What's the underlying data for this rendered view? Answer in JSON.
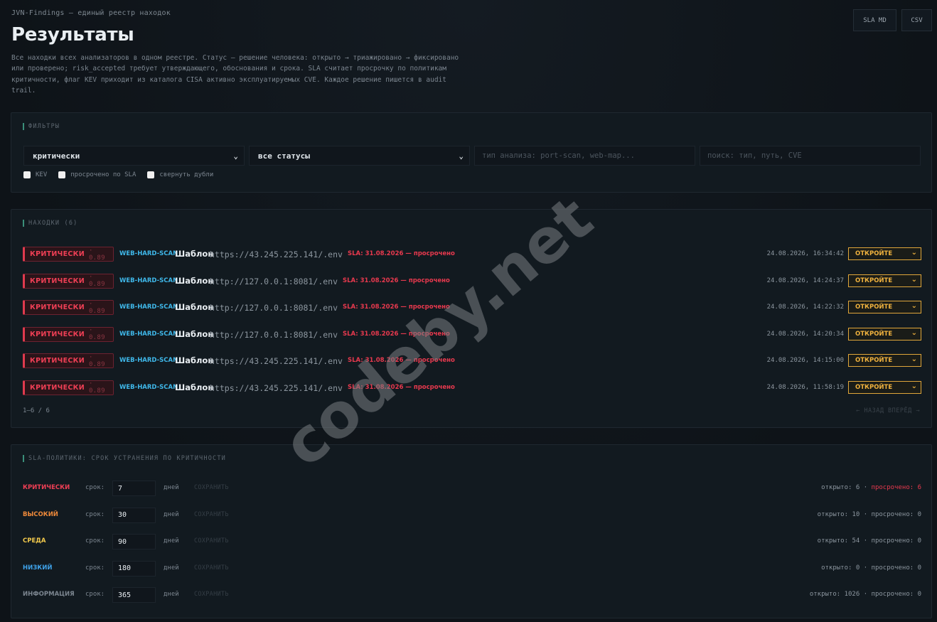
{
  "header": {
    "crumb": "JVN-Findings — единый реестр находок",
    "title": "Результаты",
    "description": "Все находки всех анализаторов в одном реестре. Статус — решение человека: открыто → триажировано → фиксировано или проверено; risk_accepted требует утверждающего, обоснования и срока. SLA считает просрочку по политикам критичности, флаг KEV приходит из каталога CISA активно эксплуатируемых CVE. Каждое решение пишется в audit trail.",
    "btn_sla_md": "SLA MD",
    "btn_csv": "CSV"
  },
  "filters": {
    "title": "ФИЛЬТРЫ",
    "severity_selected": "критически",
    "status_selected": "все статусы",
    "scan_type_placeholder": "тип анализа: port-scan, web-map...",
    "search_placeholder": "поиск: тип, путь, CVE",
    "chk_kev": "KEV",
    "chk_overdue": "просрочено по SLA",
    "chk_collapse": "свернуть дубли"
  },
  "findings": {
    "title": "НАХОДКИ (6)",
    "rows": [
      {
        "severity": "КРИТИЧЕСКИ",
        "score": "· 0.89",
        "scan": "WEB-HARD-SCAN",
        "template": "Шаблон",
        "path": "https://43.245.225.141/.env",
        "sla": "SLA: 31.08.2026 — просрочено",
        "time": "24.08.2026, 16:34:42",
        "status": "ОТКРОЙТЕ"
      },
      {
        "severity": "КРИТИЧЕСКИ",
        "score": "· 0.89",
        "scan": "WEB-HARD-SCAN",
        "template": "Шаблон",
        "path": "http://127.0.0.1:8081/.env",
        "sla": "SLA: 31.08.2026 — просрочено",
        "time": "24.08.2026, 14:24:37",
        "status": "ОТКРОЙТЕ"
      },
      {
        "severity": "КРИТИЧЕСКИ",
        "score": "· 0.89",
        "scan": "WEB-HARD-SCAN",
        "template": "Шаблон",
        "path": "http://127.0.0.1:8081/.env",
        "sla": "SLA: 31.08.2026 — просрочено",
        "time": "24.08.2026, 14:22:32",
        "status": "ОТКРОЙТЕ"
      },
      {
        "severity": "КРИТИЧЕСКИ",
        "score": "· 0.89",
        "scan": "WEB-HARD-SCAN",
        "template": "Шаблон",
        "path": "http://127.0.0.1:8081/.env",
        "sla": "SLA: 31.08.2026 — просрочено",
        "time": "24.08.2026, 14:20:34",
        "status": "ОТКРОЙТЕ"
      },
      {
        "severity": "КРИТИЧЕСКИ",
        "score": "· 0.89",
        "scan": "WEB-HARD-SCAN",
        "template": "Шаблон",
        "path": "https://43.245.225.141/.env",
        "sla": "SLA: 31.08.2026 — просрочено",
        "time": "24.08.2026, 14:15:00",
        "status": "ОТКРОЙТЕ"
      },
      {
        "severity": "КРИТИЧЕСКИ",
        "score": "· 0.89",
        "scan": "WEB-HARD-SCAN",
        "template": "Шаблон",
        "path": "https://43.245.225.141/.env",
        "sla": "SLA: 31.08.2026 — просрочено",
        "time": "24.08.2026, 11:58:19",
        "status": "ОТКРОЙТЕ"
      }
    ],
    "pager_count": "1–6 / 6",
    "pager_nav": "← НАЗАД  ВПЕРЁД →"
  },
  "sla": {
    "title": "SLA-ПОЛИТИКИ: СРОК УСТРАНЕНИЯ ПО КРИТИЧНОСТИ",
    "label_term": "срок:",
    "label_days": "дней",
    "save_label": "СОХРАНИТЬ",
    "rows": [
      {
        "severity": "КРИТИЧЕСКИ",
        "color": "#ef3f55",
        "days": "7",
        "open": "открыто: 6",
        "overdue": "просрочено: 6",
        "hot": true
      },
      {
        "severity": "ВЫСОКИЙ",
        "color": "#f08a3a",
        "days": "30",
        "open": "открыто: 10",
        "overdue": "просрочено: 0",
        "hot": false
      },
      {
        "severity": "СРЕДА",
        "color": "#f2c94c",
        "days": "90",
        "open": "открыто: 54",
        "overdue": "просрочено: 0",
        "hot": false
      },
      {
        "severity": "НИЗКИЙ",
        "color": "#3fa3ea",
        "days": "180",
        "open": "открыто: 0",
        "overdue": "просрочено: 0",
        "hot": false
      },
      {
        "severity": "ИНФОРМАЦИЯ",
        "color": "#7c8690",
        "days": "365",
        "open": "открыто: 1026",
        "overdue": "просрочено: 0",
        "hot": false
      }
    ]
  },
  "watermark": "codeby.net"
}
